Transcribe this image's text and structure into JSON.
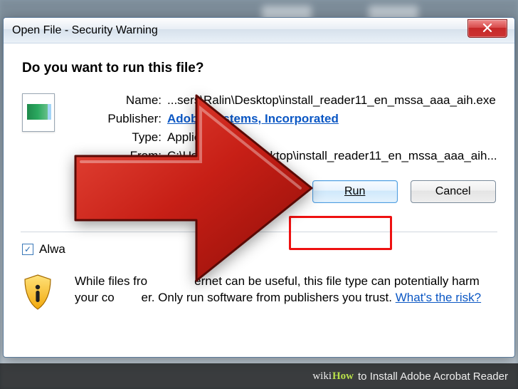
{
  "window": {
    "title": "Open File - Security Warning"
  },
  "question": "Do you want to run this file?",
  "details": {
    "name_label": "Name:",
    "name_value": "...sers\\Ralin\\Desktop\\install_reader11_en_mssa_aaa_aih.exe",
    "publisher_label": "Publisher:",
    "publisher_value": "Adobe Systems, Incorporated",
    "type_label": "Type:",
    "type_value": "Application",
    "from_label": "From:",
    "from_value": "C:\\Users\\Ralin\\Desktop\\install_reader11_en_mssa_aaa_aih..."
  },
  "buttons": {
    "run": "Run",
    "cancel": "Cancel"
  },
  "checkbox": {
    "label_visible": "Alwa",
    "checked": true
  },
  "warning": {
    "text_before": "While files fro",
    "text_mid": "ernet can be useful, this file type can potentially harm your co",
    "text_after": "er. Only run software from publishers you trust. ",
    "link": "What's the risk?"
  },
  "footer": {
    "wiki": "wiki",
    "how": "How",
    "title": " to Install Adobe Acrobat Reader"
  }
}
